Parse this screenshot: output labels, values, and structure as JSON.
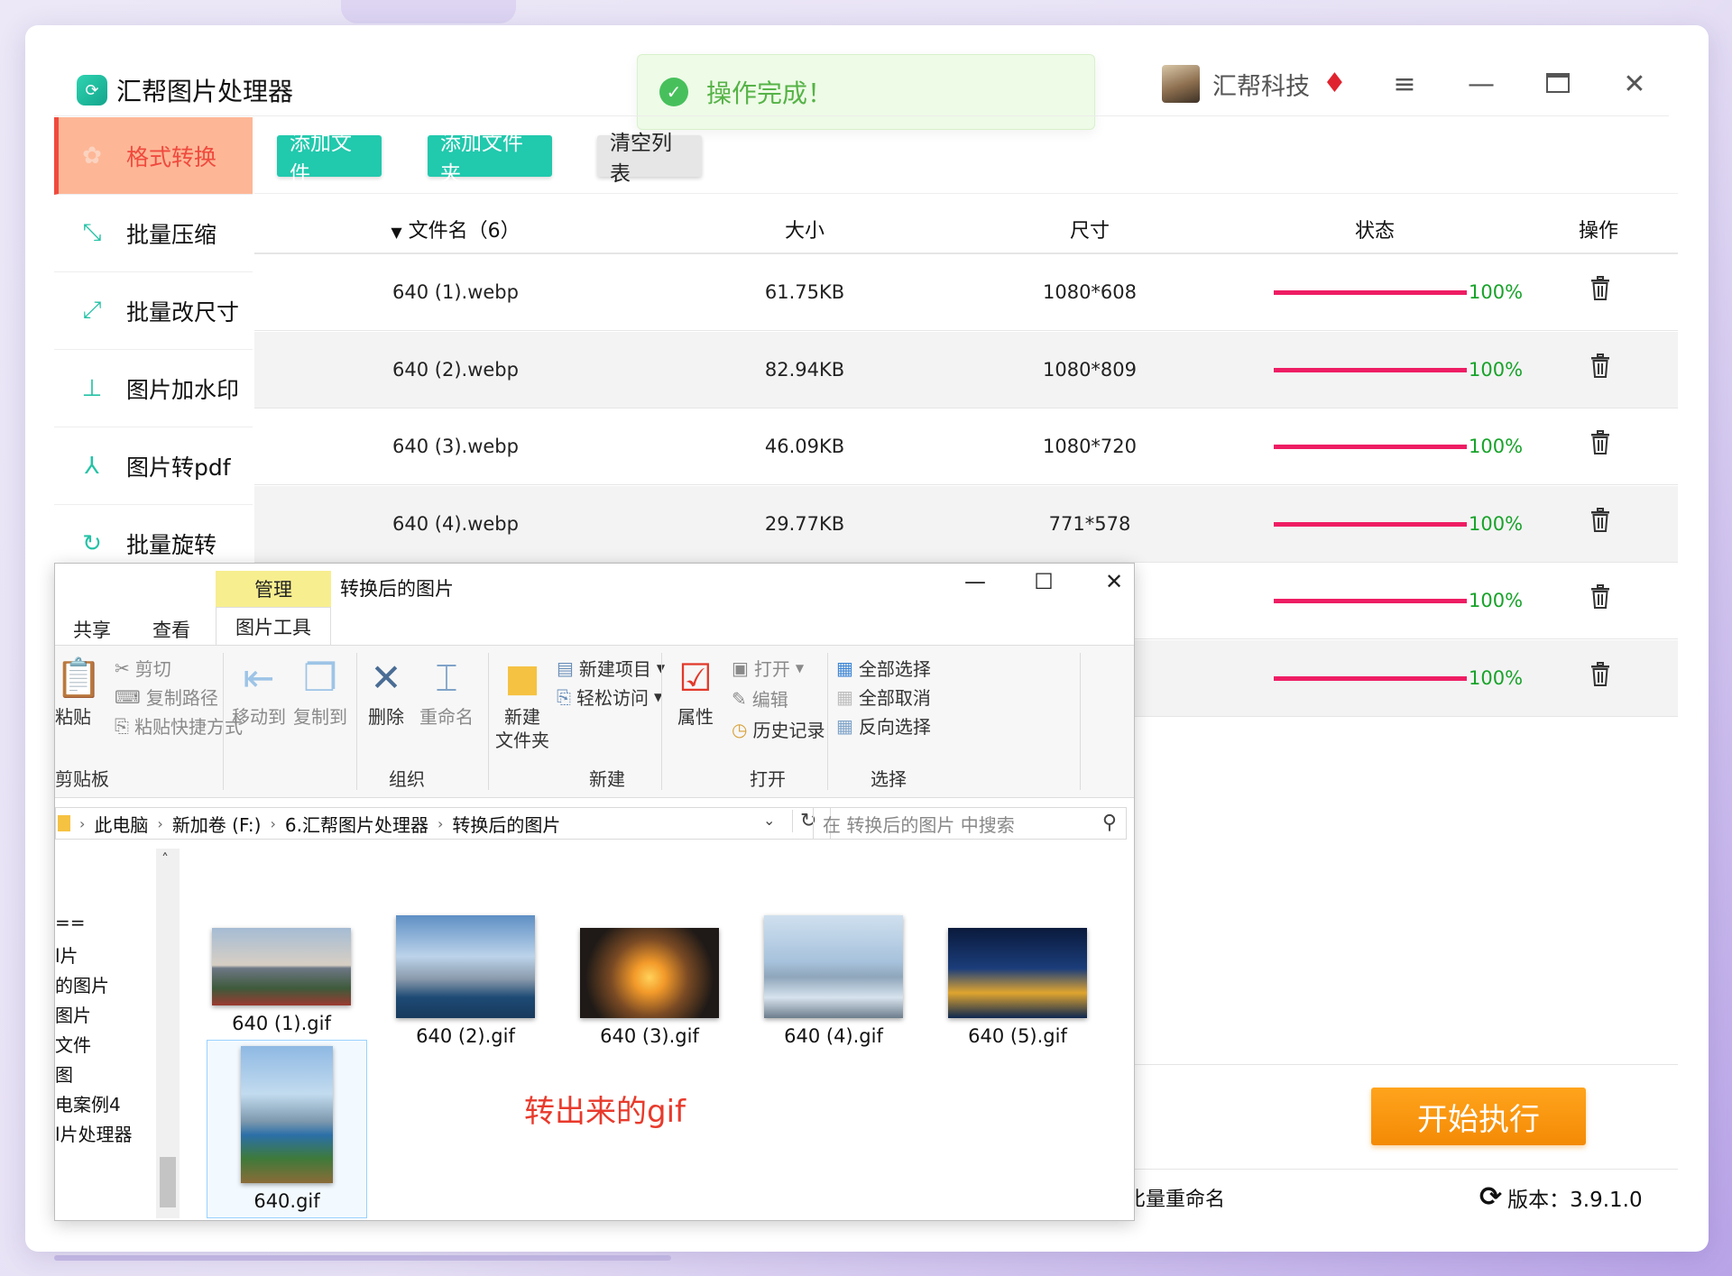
{
  "app": {
    "title": "汇帮图片处理器",
    "toast": "操作完成！",
    "user_name": "汇帮科技",
    "version_label": "版本：3.9.1.0",
    "rename_label": "比量重命名",
    "start_label": "开始执行"
  },
  "sidebar": {
    "items": [
      {
        "label": "格式转换",
        "icon": "refresh-puzzle-icon",
        "active": true
      },
      {
        "label": "批量压缩",
        "icon": "compress-arrows-icon"
      },
      {
        "label": "批量改尺寸",
        "icon": "resize-icon"
      },
      {
        "label": "图片加水印",
        "icon": "stamp-icon"
      },
      {
        "label": "图片转pdf",
        "icon": "pdf-icon"
      },
      {
        "label": "批量旋转",
        "icon": "rotate-icon"
      }
    ]
  },
  "toolbar": {
    "add_file": "添加文件",
    "add_folder": "添加文件夹",
    "clear_list": "清空列表"
  },
  "table": {
    "headers": {
      "name": "文件名（6）",
      "size": "大小",
      "dim": "尺寸",
      "status": "状态",
      "action": "操作"
    },
    "rows": [
      {
        "name": "640 (1).webp",
        "size": "61.75KB",
        "dim": "1080*608",
        "progress": 1.0,
        "progress_text": "100%"
      },
      {
        "name": "640 (2).webp",
        "size": "82.94KB",
        "dim": "1080*809",
        "progress": 1.0,
        "progress_text": "100%"
      },
      {
        "name": "640 (3).webp",
        "size": "46.09KB",
        "dim": "1080*720",
        "progress": 1.0,
        "progress_text": "100%"
      },
      {
        "name": "640 (4).webp",
        "size": "29.77KB",
        "dim": "771*578",
        "progress": 1.0,
        "progress_text": "100%"
      },
      {
        "name": "",
        "size": "",
        "dim": "",
        "progress": 1.0,
        "progress_text": "100%"
      },
      {
        "name": "",
        "size": "",
        "dim": "",
        "progress": 1.0,
        "progress_text": "100%"
      }
    ]
  },
  "explorer": {
    "manage_tab": "管理",
    "title": "转换后的图片",
    "tabs": [
      "共享",
      "查看",
      "图片工具"
    ],
    "ribbon": {
      "paste": "粘贴",
      "cut": "剪切",
      "copy_path": "复制路径",
      "paste_shortcut": "粘贴快捷方式",
      "clipboard_group": "剪贴板",
      "move_to": "移动到",
      "copy_to": "复制到",
      "delete": "删除",
      "rename": "重命名",
      "organize_group": "组织",
      "new_folder_line1": "新建",
      "new_folder_line2": "文件夹",
      "new_item": "新建项目",
      "easy_access": "轻松访问",
      "new_group": "新建",
      "properties": "属性",
      "open": "打开",
      "edit": "编辑",
      "history": "历史记录",
      "open_group": "打开",
      "select_all": "全部选择",
      "select_none": "全部取消",
      "invert_selection": "反向选择",
      "select_group": "选择"
    },
    "breadcrumb": [
      "此电脑",
      "新加卷 (F:)",
      "6.汇帮图片处理器",
      "转换后的图片"
    ],
    "search_placeholder": "在 转换后的图片 中搜索",
    "nav_items": [
      "==",
      "l片",
      "的图片",
      "图片",
      "文件",
      "图",
      "电案例4",
      "l片处理器"
    ],
    "files": [
      {
        "name": "640 (1).gif",
        "theme": "shore"
      },
      {
        "name": "640 (2).gif",
        "theme": "skyline"
      },
      {
        "name": "640 (3).gif",
        "theme": "sunset"
      },
      {
        "name": "640 (4).gif",
        "theme": "lake"
      },
      {
        "name": "640 (5).gif",
        "theme": "night"
      },
      {
        "name": "640.gif",
        "theme": "portrait"
      }
    ],
    "annotation": "转出来的gif"
  },
  "colors": {
    "accent_teal": "#21c9ad",
    "active_orange": "#fdb797",
    "active_red": "#f04a3e",
    "progress_pink": "#ee1d63",
    "progress_green": "#18a32a",
    "start_orange": "#f7920c"
  }
}
